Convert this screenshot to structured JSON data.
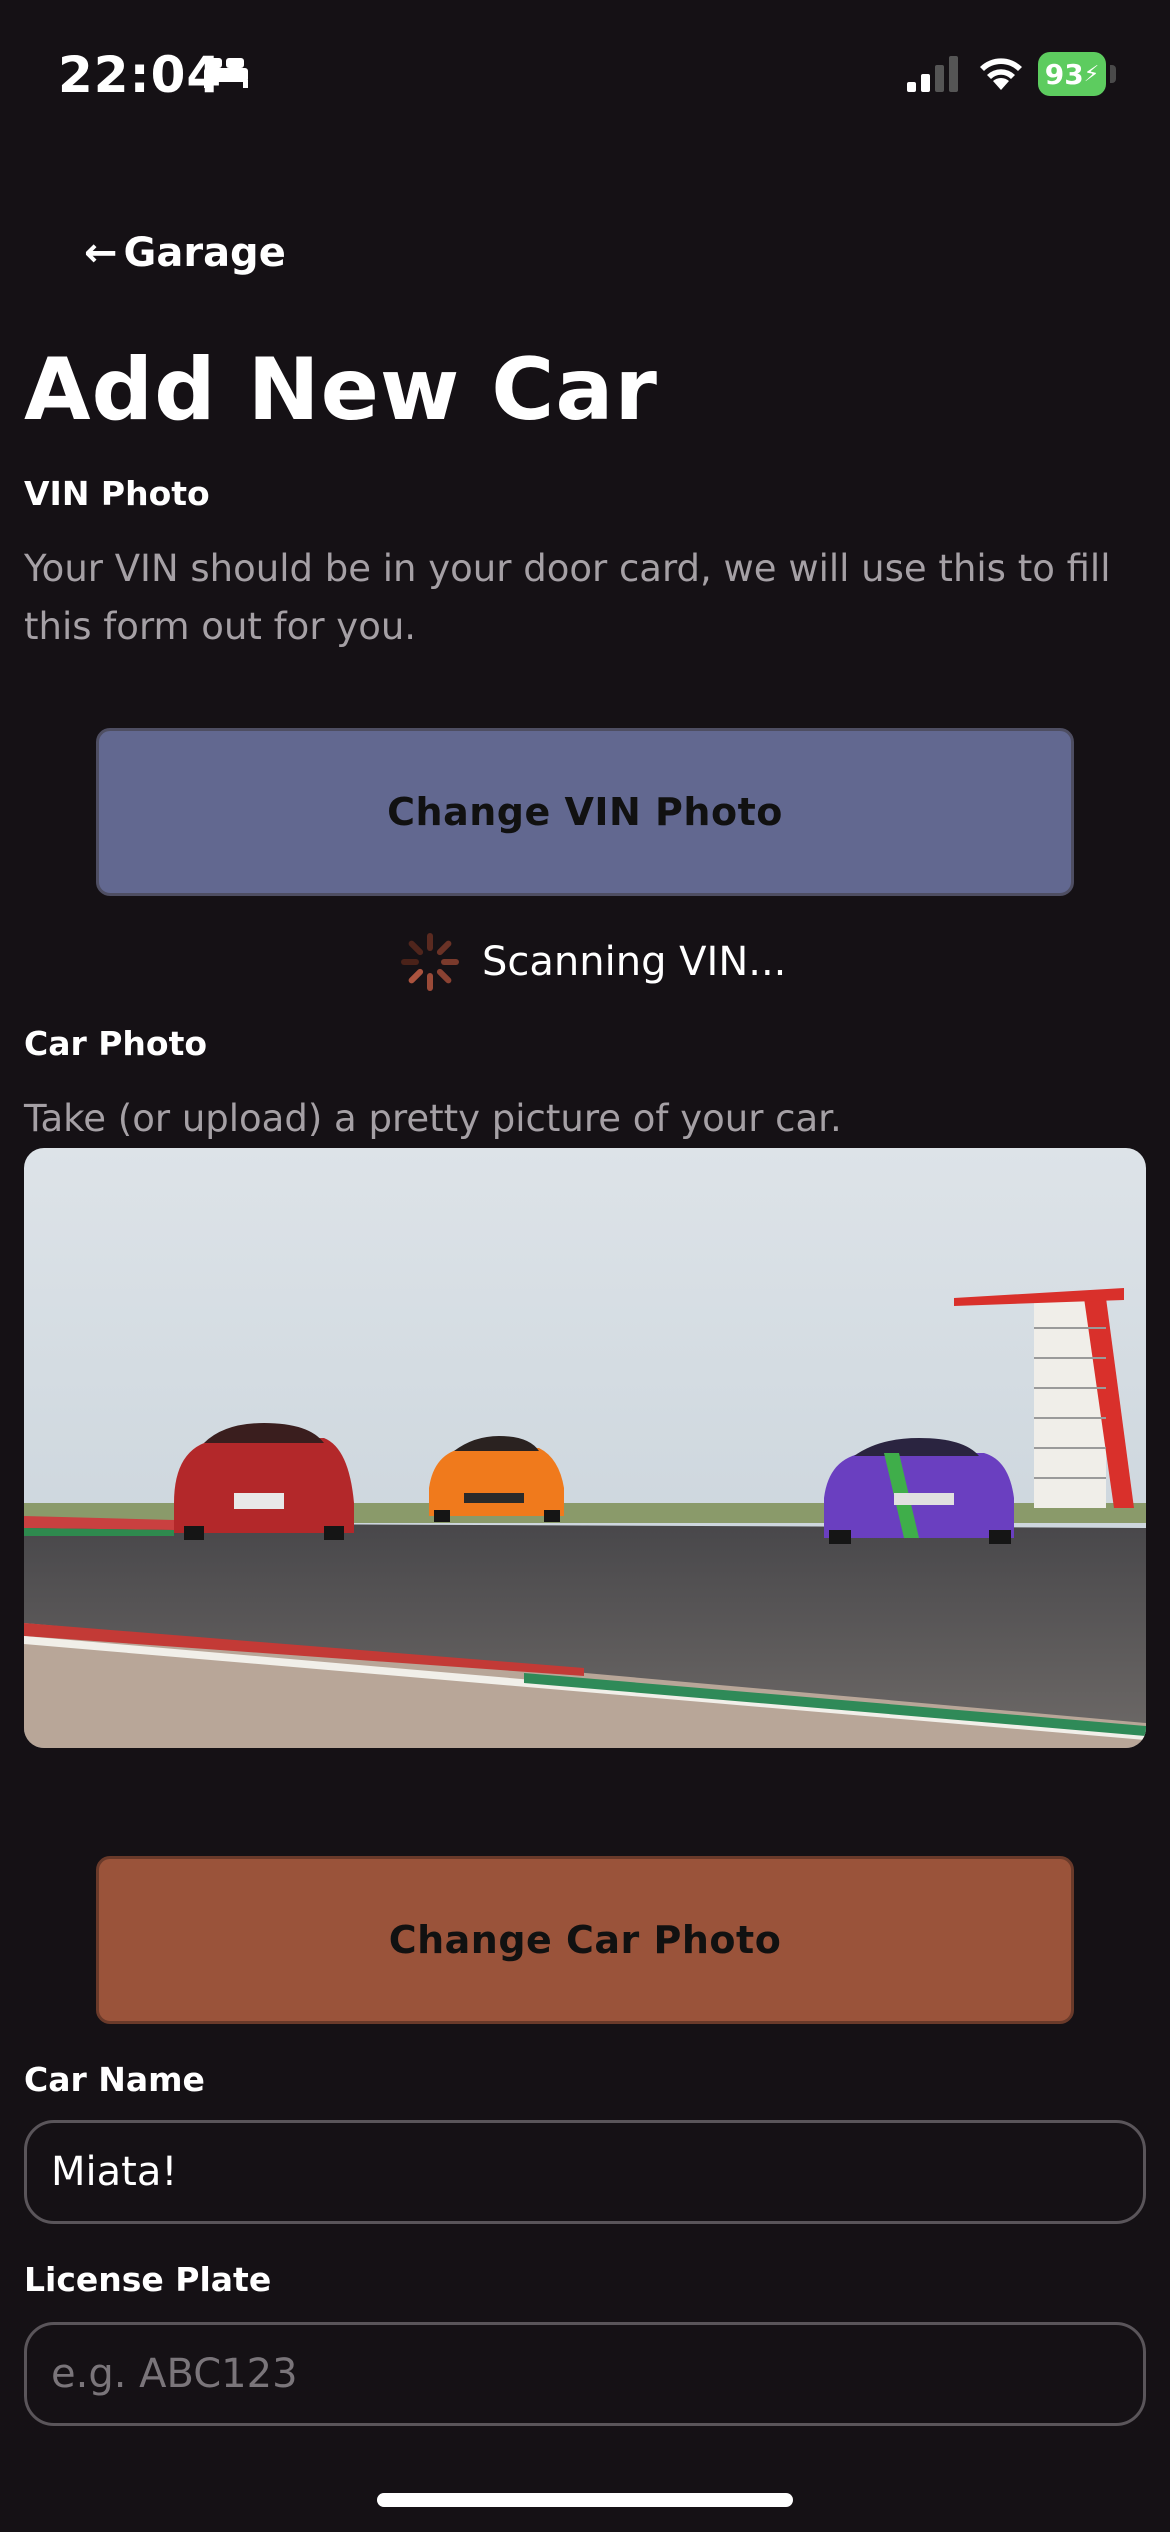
{
  "status_bar": {
    "time": "22:04",
    "battery": "93",
    "icons": [
      "bed-icon",
      "signal-icon",
      "wifi-icon",
      "battery-icon"
    ]
  },
  "nav": {
    "back_label": "Garage"
  },
  "page": {
    "title": "Add New Car"
  },
  "vin_section": {
    "label": "VIN Photo",
    "description": "Your VIN should be in your door card, we will use this to fill this form out for you.",
    "button_label": "Change VIN Photo",
    "scanning_text": "Scanning VIN..."
  },
  "car_photo_section": {
    "label": "Car Photo",
    "description": "Take (or upload) a pretty picture of your car.",
    "button_label": "Change Car Photo"
  },
  "car_name": {
    "label": "Car Name",
    "value": "Miata!"
  },
  "license_plate": {
    "label": "License Plate",
    "placeholder": "e.g. ABC123"
  },
  "colors": {
    "background": "#151115",
    "vin_button": "#626890",
    "car_button": "#9a533a",
    "battery": "#5dcc5f"
  }
}
